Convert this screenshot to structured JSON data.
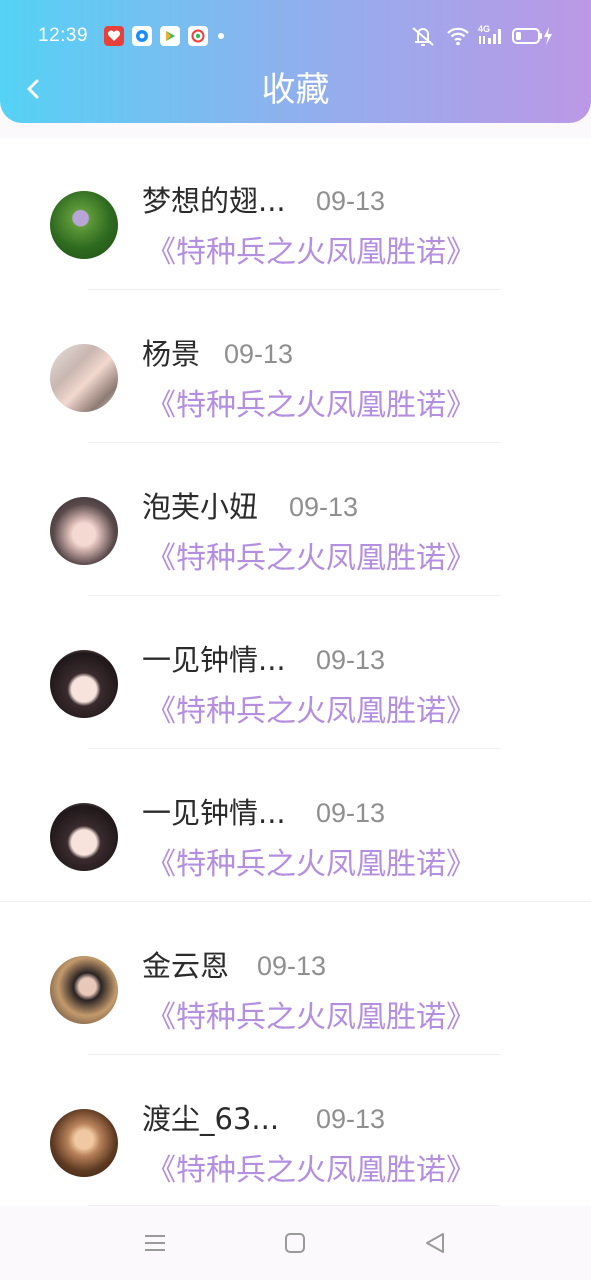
{
  "status_bar": {
    "time": "12:39",
    "network_label": "4G",
    "icons": [
      "app-heart-icon",
      "app-blue-circle-icon",
      "app-play-icon",
      "app-camera-icon",
      "notification-dot",
      "mute-icon",
      "wifi-icon",
      "signal-icon",
      "battery-icon",
      "charging-icon"
    ]
  },
  "header": {
    "title": "收藏",
    "back_icon": "chevron-left-icon",
    "accent_start": "#55d2f5",
    "accent_end": "#bc98e6"
  },
  "items": [
    {
      "name": "梦想的翅...",
      "date": "09-13",
      "book": "《特种兵之火凤凰胜诺》"
    },
    {
      "name": "杨景",
      "date": "09-13",
      "book": "《特种兵之火凤凰胜诺》"
    },
    {
      "name": "泡芙小妞",
      "date": "09-13",
      "book": "《特种兵之火凤凰胜诺》"
    },
    {
      "name": "一见钟情...",
      "date": "09-13",
      "book": "《特种兵之火凤凰胜诺》"
    },
    {
      "name": "一见钟情...",
      "date": "09-13",
      "book": "《特种兵之火凤凰胜诺》"
    },
    {
      "name": "金云恩",
      "date": "09-13",
      "book": "《特种兵之火凤凰胜诺》"
    },
    {
      "name": "渡尘_63...",
      "date": "09-13",
      "book": "《特种兵之火凤凰胜诺》"
    }
  ],
  "colors": {
    "book_title": "#b48fe0",
    "name_text": "#2b2b2b",
    "date_text": "#8f8f8f"
  },
  "nav_bar": {
    "icons": [
      "menu-icon",
      "home-square-icon",
      "back-triangle-icon"
    ]
  }
}
